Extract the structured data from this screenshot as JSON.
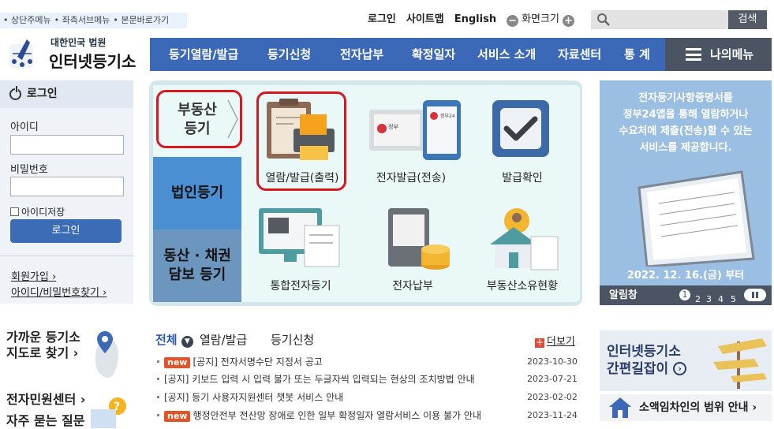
{
  "skip_links": [
    "상단주메뉴",
    "좌측서브메뉴",
    "본문바로가기"
  ],
  "util": {
    "login": "로그인",
    "sitemap": "사이트맵",
    "english": "English",
    "zoom_label": "화면크기",
    "zoom_minus": "−",
    "zoom_plus": "+"
  },
  "search": {
    "placeholder": "",
    "button": "검색"
  },
  "logo": {
    "line1": "대한민국 법원",
    "line2": "인터넷등기소"
  },
  "gnb": [
    "등기열람/발급",
    "등기신청",
    "전자납부",
    "확정일자",
    "서비스 소개",
    "자료센터",
    "통 계"
  ],
  "my_menu": "나의메뉴",
  "login_box": {
    "title": "로그인",
    "id_label": "아이디",
    "pw_label": "비밀번호",
    "remember": "아이디저장",
    "login_button": "로그인",
    "join": "회원가입",
    "find": "아이디/비밀번호찾기"
  },
  "side_tabs": {
    "real_estate": "부동산\n등기",
    "corporate": "법인등기",
    "movable": "동산 · 채권\n담보 등기"
  },
  "services": [
    {
      "label": "열람/발급(출력)",
      "icon": "printer-document-icon"
    },
    {
      "label": "전자발급(전송)",
      "icon": "electronic-certificate-icon"
    },
    {
      "label": "발급확인",
      "icon": "check-badge-icon"
    },
    {
      "label": "통합전자등기",
      "icon": "monitor-document-icon"
    },
    {
      "label": "전자납부",
      "icon": "payment-coins-icon"
    },
    {
      "label": "부동산소유현황",
      "icon": "house-owner-icon"
    }
  ],
  "tablet_heading": "정부",
  "tablet_app": "정부24",
  "banner": {
    "text": "전자등기사항증명서를\n정부24앱을 통해 열람하거나\n수요처에 제출(전송)할 수 있는\n서비스를 제공합니다.",
    "date": "2022. 12. 16.(금) 부터"
  },
  "notice_bar": {
    "title": "알림창",
    "pages": [
      "1",
      "2",
      "3",
      "4",
      "5"
    ]
  },
  "quick": {
    "nearby_line1": "가까운 등기소",
    "nearby_line2": "지도로 찾기",
    "civil": "전자민원센터",
    "faq": "자주 묻는 질문"
  },
  "news": {
    "tabs": [
      "전체",
      "열람/발급",
      "등기신청"
    ],
    "more": "더보기",
    "items": [
      {
        "new": true,
        "badge": "new",
        "title": "[공지] 전자서명수단 지정서 공고",
        "date": "2023-10-30"
      },
      {
        "new": false,
        "badge": "",
        "title": "[공지] 키보드 입력 시 입력 불가 또는 두글자씩 입력되는 현상의 조치방법 안내",
        "date": "2023-07-21"
      },
      {
        "new": false,
        "badge": "",
        "title": "[공지] 등기 사용자지원센터 챗봇 서비스 안내",
        "date": "2023-02-02"
      },
      {
        "new": true,
        "badge": "new",
        "title": "행정안전부 전산망 장애로 인한 일부 확정일자 열람서비스 이용 불가 안내",
        "date": "2023-11-24"
      }
    ]
  },
  "guide": {
    "line1": "인터넷등기소",
    "line2": "간편길잡이"
  },
  "lease": "소액임차인의 범위 안내",
  "colors": {
    "nav_blue": "#3b69b7",
    "highlight_red": "#d8171f",
    "new_badge": "#e45327"
  }
}
